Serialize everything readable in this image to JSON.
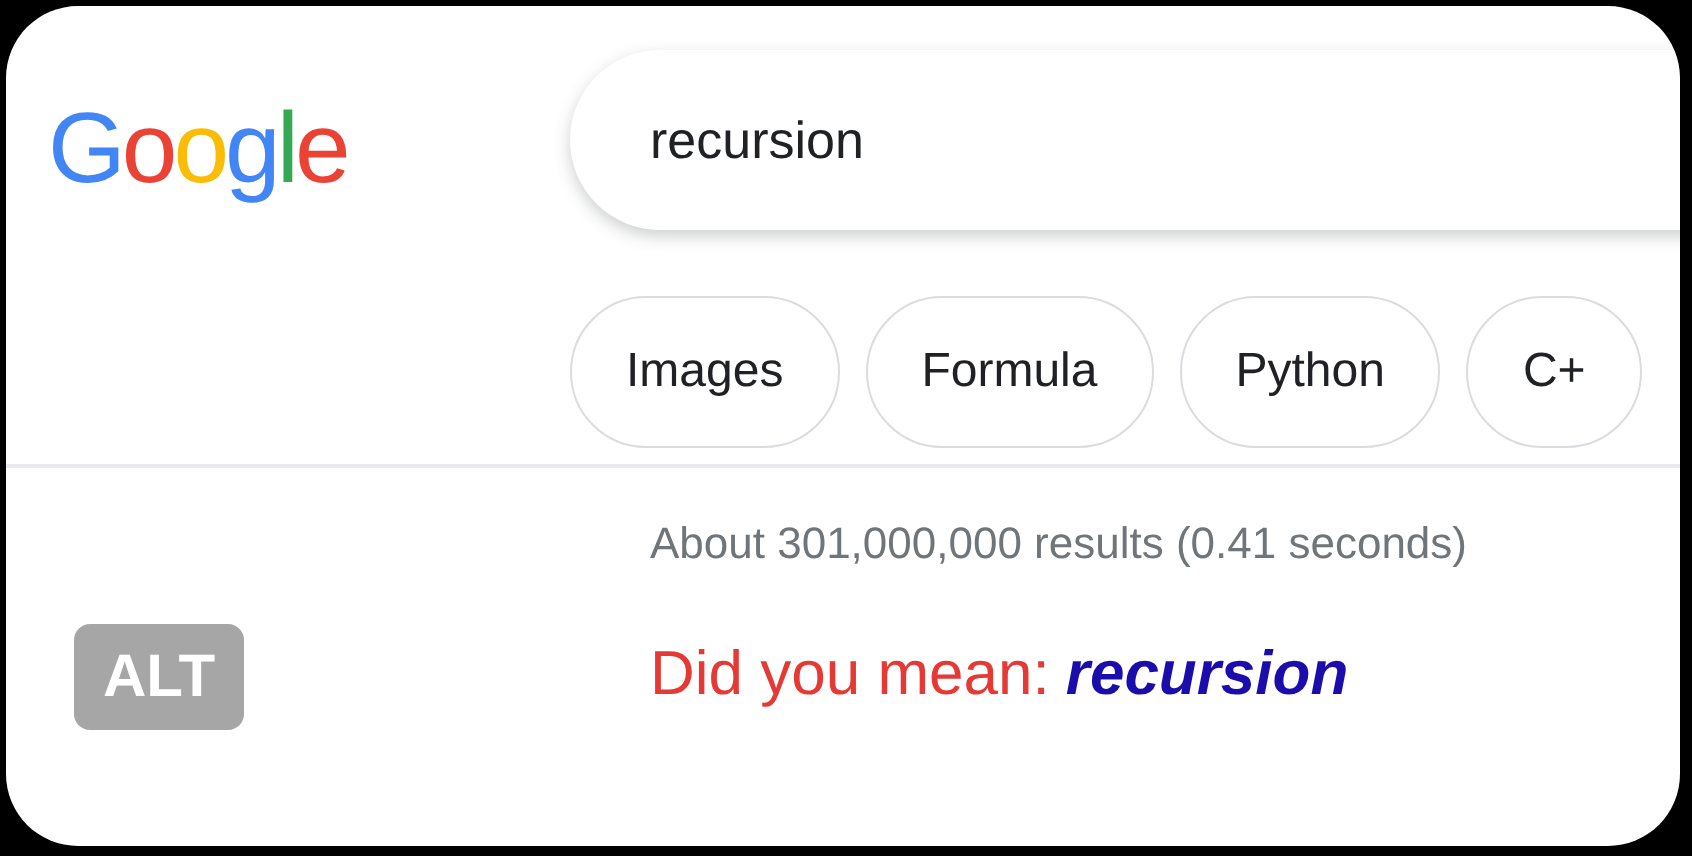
{
  "logo": {
    "text": "Google"
  },
  "search": {
    "value": "recursion"
  },
  "chips": [
    {
      "label": "Images"
    },
    {
      "label": "Formula"
    },
    {
      "label": "Python"
    },
    {
      "label": "C+"
    }
  ],
  "result_stats": "About 301,000,000 results (0.41 seconds)",
  "spelling": {
    "prompt": "Did you mean:",
    "suggestion": "recursion"
  },
  "alt_badge": "ALT"
}
